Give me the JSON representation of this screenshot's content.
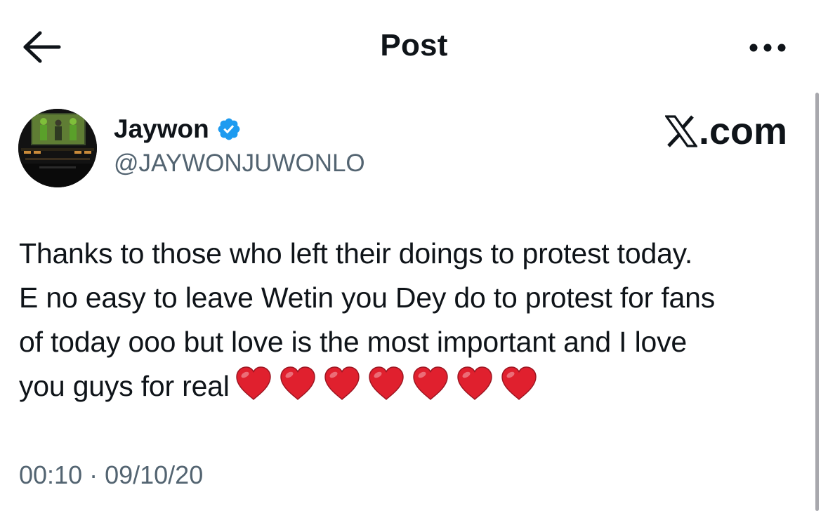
{
  "header": {
    "title": "Post",
    "back_icon": "arrow-left-icon",
    "more_icon": "more-horizontal-icon"
  },
  "author": {
    "display_name": "Jaywon",
    "handle": "@JAYWONJUWONLO",
    "verified": true,
    "verified_color": "#1d9bf0",
    "avatar_icon": "avatar-image"
  },
  "source": {
    "label": ".com",
    "logo_icon": "x-logo-icon"
  },
  "tweet": {
    "text_lines": [
      "Thanks to those who left their doings to protest today.",
      "E no easy to leave Wetin you Dey do to protest for fans",
      "of today ooo but love is the most important and I love",
      "you guys for real"
    ],
    "emoji": [
      "❤️",
      "❤️",
      "❤️",
      "❤️",
      "❤️",
      "❤️",
      "❤️"
    ],
    "heart_color": "#e0202e"
  },
  "timestamp": {
    "text": "00:10 · 09/10/20"
  },
  "colors": {
    "text_primary": "#0f1419",
    "text_secondary": "#536471",
    "background": "#ffffff"
  }
}
